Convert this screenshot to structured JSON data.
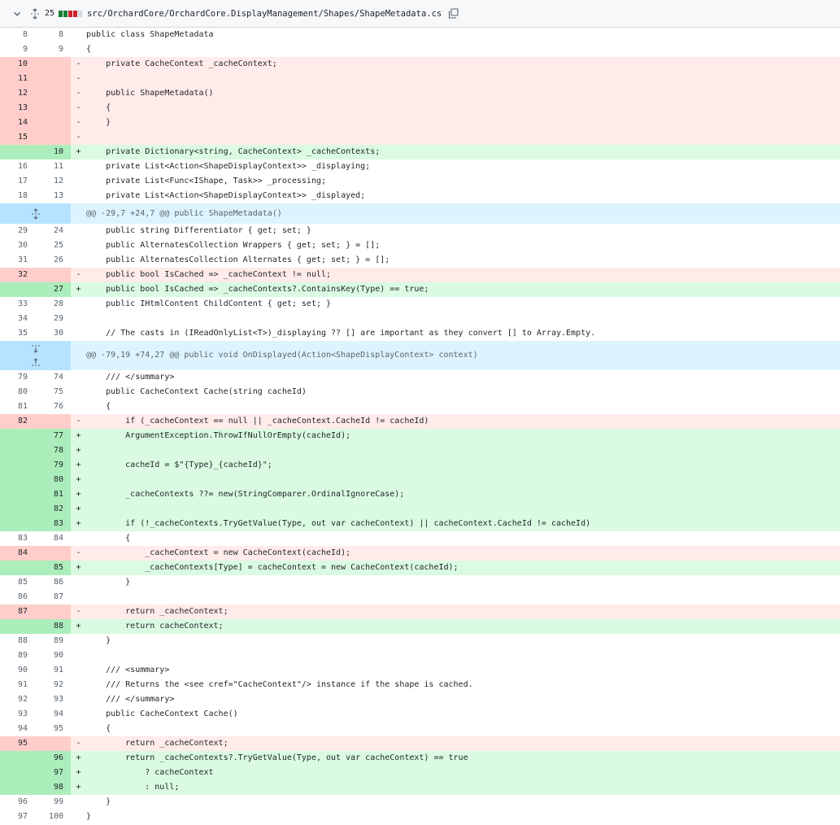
{
  "file": {
    "changes_count": "25",
    "path": "src/OrchardCore/OrchardCore.DisplayManagement/Shapes/ShapeMetadata.cs",
    "diffstat": [
      "add",
      "add",
      "del",
      "del",
      "neutral"
    ],
    "colors": {
      "add": "#1a7f37",
      "del": "#cf222e",
      "neutral": "#d1d9e0"
    }
  },
  "lines": [
    {
      "type": "ctx",
      "old": "8",
      "new": "8",
      "mark": "",
      "code": "public class ShapeMetadata"
    },
    {
      "type": "ctx",
      "old": "9",
      "new": "9",
      "mark": "",
      "code": "{"
    },
    {
      "type": "del",
      "old": "10",
      "new": "",
      "mark": "-",
      "code": "    private CacheContext _cacheContext;"
    },
    {
      "type": "del",
      "old": "11",
      "new": "",
      "mark": "-",
      "code": ""
    },
    {
      "type": "del",
      "old": "12",
      "new": "",
      "mark": "-",
      "code": "    public ShapeMetadata()"
    },
    {
      "type": "del",
      "old": "13",
      "new": "",
      "mark": "-",
      "code": "    {"
    },
    {
      "type": "del",
      "old": "14",
      "new": "",
      "mark": "-",
      "code": "    }"
    },
    {
      "type": "del",
      "old": "15",
      "new": "",
      "mark": "-",
      "code": ""
    },
    {
      "type": "add",
      "old": "",
      "new": "10",
      "mark": "+",
      "code": "    private Dictionary<string, CacheContext> _cacheContexts;"
    },
    {
      "type": "ctx",
      "old": "16",
      "new": "11",
      "mark": "",
      "code": "    private List<Action<ShapeDisplayContext>> _displaying;"
    },
    {
      "type": "ctx",
      "old": "17",
      "new": "12",
      "mark": "",
      "code": "    private List<Func<IShape, Task>> _processing;"
    },
    {
      "type": "ctx",
      "old": "18",
      "new": "13",
      "mark": "",
      "code": "    private List<Action<ShapeDisplayContext>> _displayed;"
    },
    {
      "type": "hunk",
      "size": "h1",
      "code": "@@ -29,7 +24,7 @@ public ShapeMetadata()"
    },
    {
      "type": "ctx",
      "old": "29",
      "new": "24",
      "mark": "",
      "code": "    public string Differentiator { get; set; }"
    },
    {
      "type": "ctx",
      "old": "30",
      "new": "25",
      "mark": "",
      "code": "    public AlternatesCollection Wrappers { get; set; } = [];"
    },
    {
      "type": "ctx",
      "old": "31",
      "new": "26",
      "mark": "",
      "code": "    public AlternatesCollection Alternates { get; set; } = [];"
    },
    {
      "type": "del",
      "old": "32",
      "new": "",
      "mark": "-",
      "code": "    public bool IsCached => _cacheContext != null;"
    },
    {
      "type": "add",
      "old": "",
      "new": "27",
      "mark": "+",
      "code": "    public bool IsCached => _cacheContexts?.ContainsKey(Type) == true;"
    },
    {
      "type": "ctx",
      "old": "33",
      "new": "28",
      "mark": "",
      "code": "    public IHtmlContent ChildContent { get; set; }"
    },
    {
      "type": "ctx",
      "old": "34",
      "new": "29",
      "mark": "",
      "code": ""
    },
    {
      "type": "ctx",
      "old": "35",
      "new": "30",
      "mark": "",
      "code": "    // The casts in (IReadOnlyList<T>)_displaying ?? [] are important as they convert [] to Array.Empty."
    },
    {
      "type": "hunk",
      "size": "h2",
      "code": "@@ -79,19 +74,27 @@ public void OnDisplayed(Action<ShapeDisplayContext> context)"
    },
    {
      "type": "ctx",
      "old": "79",
      "new": "74",
      "mark": "",
      "code": "    /// </summary>"
    },
    {
      "type": "ctx",
      "old": "80",
      "new": "75",
      "mark": "",
      "code": "    public CacheContext Cache(string cacheId)"
    },
    {
      "type": "ctx",
      "old": "81",
      "new": "76",
      "mark": "",
      "code": "    {"
    },
    {
      "type": "del",
      "old": "82",
      "new": "",
      "mark": "-",
      "code": "        if (_cacheContext == null || _cacheContext.CacheId != cacheId)"
    },
    {
      "type": "add",
      "old": "",
      "new": "77",
      "mark": "+",
      "code": "        ArgumentException.ThrowIfNullOrEmpty(cacheId);"
    },
    {
      "type": "add",
      "old": "",
      "new": "78",
      "mark": "+",
      "code": ""
    },
    {
      "type": "add",
      "old": "",
      "new": "79",
      "mark": "+",
      "code": "        cacheId = $\"{Type}_{cacheId}\";"
    },
    {
      "type": "add",
      "old": "",
      "new": "80",
      "mark": "+",
      "code": ""
    },
    {
      "type": "add",
      "old": "",
      "new": "81",
      "mark": "+",
      "code": "        _cacheContexts ??= new(StringComparer.OrdinalIgnoreCase);"
    },
    {
      "type": "add",
      "old": "",
      "new": "82",
      "mark": "+",
      "code": ""
    },
    {
      "type": "add",
      "old": "",
      "new": "83",
      "mark": "+",
      "code": "        if (!_cacheContexts.TryGetValue(Type, out var cacheContext) || cacheContext.CacheId != cacheId)"
    },
    {
      "type": "ctx",
      "old": "83",
      "new": "84",
      "mark": "",
      "code": "        {"
    },
    {
      "type": "del",
      "old": "84",
      "new": "",
      "mark": "-",
      "code": "            _cacheContext = new CacheContext(cacheId);"
    },
    {
      "type": "add",
      "old": "",
      "new": "85",
      "mark": "+",
      "code": "            _cacheContexts[Type] = cacheContext = new CacheContext(cacheId);"
    },
    {
      "type": "ctx",
      "old": "85",
      "new": "86",
      "mark": "",
      "code": "        }"
    },
    {
      "type": "ctx",
      "old": "86",
      "new": "87",
      "mark": "",
      "code": ""
    },
    {
      "type": "del",
      "old": "87",
      "new": "",
      "mark": "-",
      "code": "        return _cacheContext;"
    },
    {
      "type": "add",
      "old": "",
      "new": "88",
      "mark": "+",
      "code": "        return cacheContext;"
    },
    {
      "type": "ctx",
      "old": "88",
      "new": "89",
      "mark": "",
      "code": "    }"
    },
    {
      "type": "ctx",
      "old": "89",
      "new": "90",
      "mark": "",
      "code": ""
    },
    {
      "type": "ctx",
      "old": "90",
      "new": "91",
      "mark": "",
      "code": "    /// <summary>"
    },
    {
      "type": "ctx",
      "old": "91",
      "new": "92",
      "mark": "",
      "code": "    /// Returns the <see cref=\"CacheContext\"/> instance if the shape is cached."
    },
    {
      "type": "ctx",
      "old": "92",
      "new": "93",
      "mark": "",
      "code": "    /// </summary>"
    },
    {
      "type": "ctx",
      "old": "93",
      "new": "94",
      "mark": "",
      "code": "    public CacheContext Cache()"
    },
    {
      "type": "ctx",
      "old": "94",
      "new": "95",
      "mark": "",
      "code": "    {"
    },
    {
      "type": "del",
      "old": "95",
      "new": "",
      "mark": "-",
      "code": "        return _cacheContext;"
    },
    {
      "type": "add",
      "old": "",
      "new": "96",
      "mark": "+",
      "code": "        return _cacheContexts?.TryGetValue(Type, out var cacheContext) == true"
    },
    {
      "type": "add",
      "old": "",
      "new": "97",
      "mark": "+",
      "code": "            ? cacheContext"
    },
    {
      "type": "add",
      "old": "",
      "new": "98",
      "mark": "+",
      "code": "            : null;"
    },
    {
      "type": "ctx",
      "old": "96",
      "new": "99",
      "mark": "",
      "code": "    }"
    },
    {
      "type": "ctx",
      "old": "97",
      "new": "100",
      "mark": "",
      "code": "}"
    }
  ]
}
